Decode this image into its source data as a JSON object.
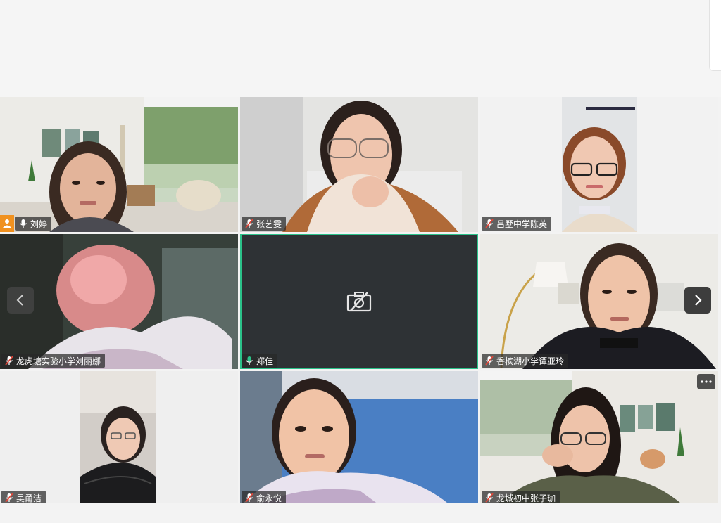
{
  "participants": [
    {
      "name": "刘婷",
      "host": true,
      "mic": "on"
    },
    {
      "name": "张艺雯",
      "mic": "muted"
    },
    {
      "name": "吕墅中学陈英",
      "mic": "muted"
    },
    {
      "name": "龙虎塘实验小学刘丽娜",
      "mic": "muted"
    },
    {
      "name": "郑佳",
      "mic": "speaking",
      "camera": "off"
    },
    {
      "name": "香槟湖小学谭亚玲",
      "mic": "muted"
    },
    {
      "name": "吴甬洁",
      "mic": "muted"
    },
    {
      "name": "俞永悦",
      "mic": "muted"
    },
    {
      "name": "龙城初中张子珈",
      "mic": "muted"
    }
  ],
  "icons": {
    "prev": "chevron-left-icon",
    "next": "chevron-right-icon",
    "more": "more-icon",
    "camera_off": "camera-off-icon",
    "mic_muted": "mic-muted-icon",
    "host": "host-icon"
  },
  "colors": {
    "active_border": "#2bc28a",
    "host_badge": "#f0911f",
    "muted_icon": "#e0483a",
    "speaking_icon": "#2bc28a"
  }
}
